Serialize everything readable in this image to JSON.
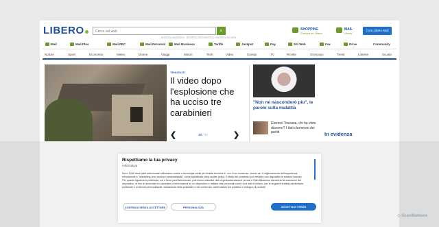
{
  "header": {
    "logo": "LIBERO",
    "search_placeholder": "Cerca nel web",
    "sub_links": "RICERCA AVANZATA · RICERCA GEOGRAFICA · RICERCA SICURA",
    "shopping": {
      "label": "SHOPPING",
      "sub": "Compra su Libero"
    },
    "mail": {
      "label": "MAIL",
      "sub": "Libero"
    },
    "libero_mail_button": "Crea Libero Mail"
  },
  "services": [
    "Mail",
    "Mail Plus",
    "Mail PEC",
    "Mail Personal",
    "Mail Business",
    "Tariffe",
    "Jackpot",
    "Pay",
    "Siti Web",
    "Fax",
    "Drive",
    "Community"
  ],
  "sections": [
    "Notizie",
    "Sport",
    "Economia",
    "Meteo",
    "Donne",
    "Viaggi",
    "Motori",
    "Tech",
    "Video",
    "Gossip",
    "TV",
    "Ricette",
    "Oroscopo",
    "Trenti",
    "Lotterie",
    "Scuola"
  ],
  "hero": {
    "tag": "TENDENZE",
    "title": "Il video dopo l'esplosione che ha ucciso tre carabinieri",
    "prev": "❮",
    "next": "❯",
    "page_current": "10",
    "page_total": "/ 30"
  },
  "right_column": {
    "main_title": "\"Non mi nasconderò più\", le parole sulla malattia",
    "small_title": "Elezioni Toscana, chi ha vinto davvero? I dati clamorosi dei partiti",
    "in_evidenza": "In evidenza"
  },
  "cookie_dialog": {
    "title": "Rispettiamo la tua privacy",
    "subtitle": "Informativa",
    "body_1": "Noi e 1060 terze parti selezionate utilizziamo cookie o tecnologie simili per finalità tecniche e, con il tuo consenso, anche per il miglioramento dell'esperienza, misurazione e \"marketing (con annunci personalizzati)\" come specificato nella cookie policy. Il rifiuto del consenso può rendere non disponibili le relative funzioni.",
    "body_2": "Per quanto riguarda la pubblicità, noi e terze parti selezionate, potremmo utilizzare dati di geolocalizzazione precisi e l'identificazione attraverso la scansione del dispositivo, al fine di archiviare e/o accedere a informazioni su un dispositivo e trattare dati personali come i tuoi dati di utilizzo, per le seguenti finalità pubblicitarie: pubblicità e contenuti personalizzati, valutazione della pubblicità e del contenuto, osservazioni del pubblico e sviluppo di prodotti.",
    "btn_continue": "CONTINUA SENZA ACCETTARE",
    "btn_customize": "PERSONALIZZA",
    "btn_accept": "ACCETTA E CHIUDI"
  },
  "watermark": "ScanMalware",
  "colors": {
    "brand_blue": "#1f4f9c",
    "accent_green": "#6a9a2a",
    "button_blue": "#1f6fc8"
  }
}
